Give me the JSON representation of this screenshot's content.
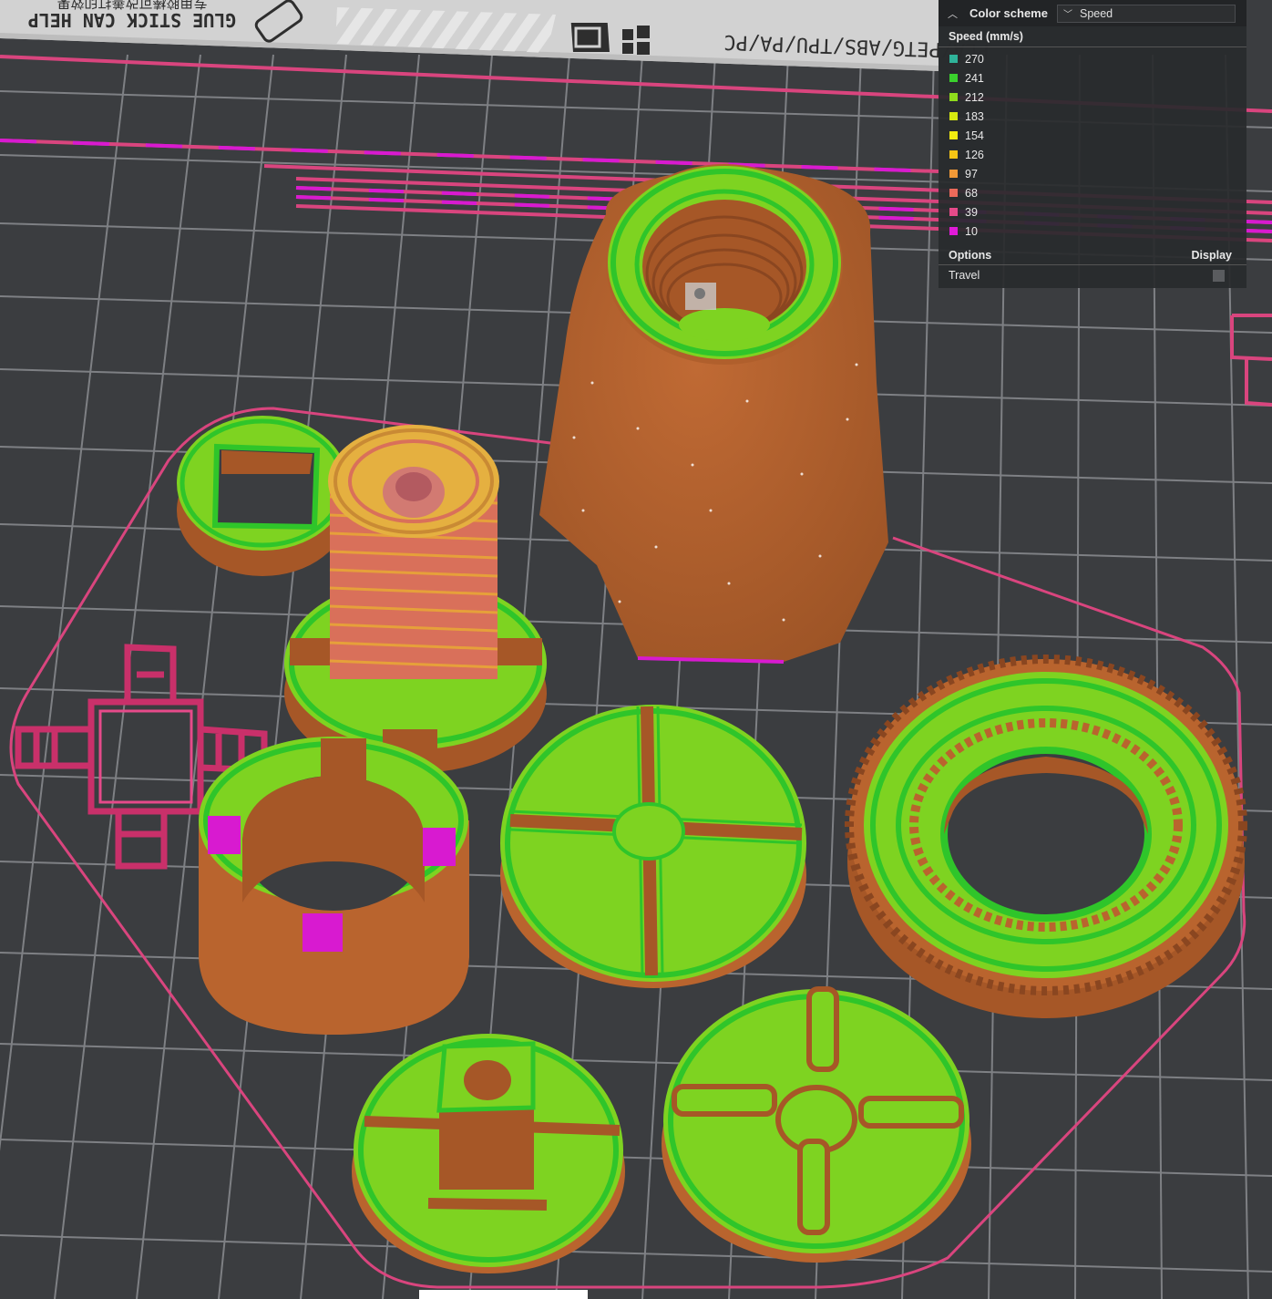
{
  "bed": {
    "plate_text": "GLUE STICK CAN HELP",
    "plate_subtext": "专用胶棒可改善打印效果",
    "materials_text": "PLA/PETG/ABS/TPU/PA/PC"
  },
  "legend": {
    "header_title": "Color scheme",
    "scheme_value": "Speed",
    "subtitle": "Speed (mm/s)",
    "items": [
      {
        "label": "270",
        "color": "#2fb39a"
      },
      {
        "label": "241",
        "color": "#3ad12d"
      },
      {
        "label": "212",
        "color": "#8fdc1c"
      },
      {
        "label": "183",
        "color": "#d6ea10"
      },
      {
        "label": "154",
        "color": "#f2ec10"
      },
      {
        "label": "126",
        "color": "#f5c515"
      },
      {
        "label": "97",
        "color": "#f29a37"
      },
      {
        "label": "68",
        "color": "#ec6a5a"
      },
      {
        "label": "39",
        "color": "#e64a8a"
      },
      {
        "label": "10",
        "color": "#e11ad8"
      }
    ],
    "options_label": "Options",
    "display_label": "Display",
    "travel_label": "Travel"
  },
  "colors": {
    "bed": "#3b3d40",
    "grid": "#8a8c90",
    "wall": "#b9642e",
    "infill": "#7ed321",
    "perimeter": "#2fc52a",
    "travel": "#d9457e",
    "slow": "#d81ad0"
  }
}
